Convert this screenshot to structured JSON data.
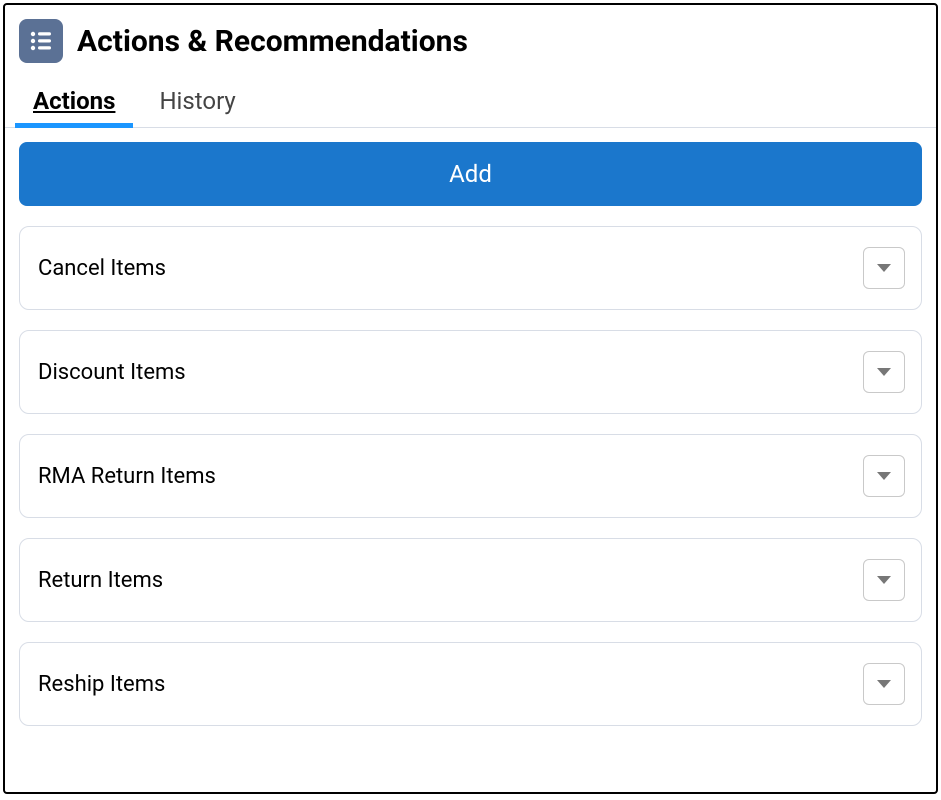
{
  "header": {
    "title": "Actions & Recommendations"
  },
  "tabs": [
    {
      "label": "Actions",
      "active": true
    },
    {
      "label": "History",
      "active": false
    }
  ],
  "add_button": {
    "label": "Add"
  },
  "actions": [
    {
      "label": "Cancel Items"
    },
    {
      "label": "Discount Items"
    },
    {
      "label": "RMA Return Items"
    },
    {
      "label": "Return Items"
    },
    {
      "label": "Reship Items"
    }
  ],
  "colors": {
    "accent": "#1b96ff",
    "primary_button": "#1b77cc",
    "header_icon_bg": "#5b7195"
  }
}
